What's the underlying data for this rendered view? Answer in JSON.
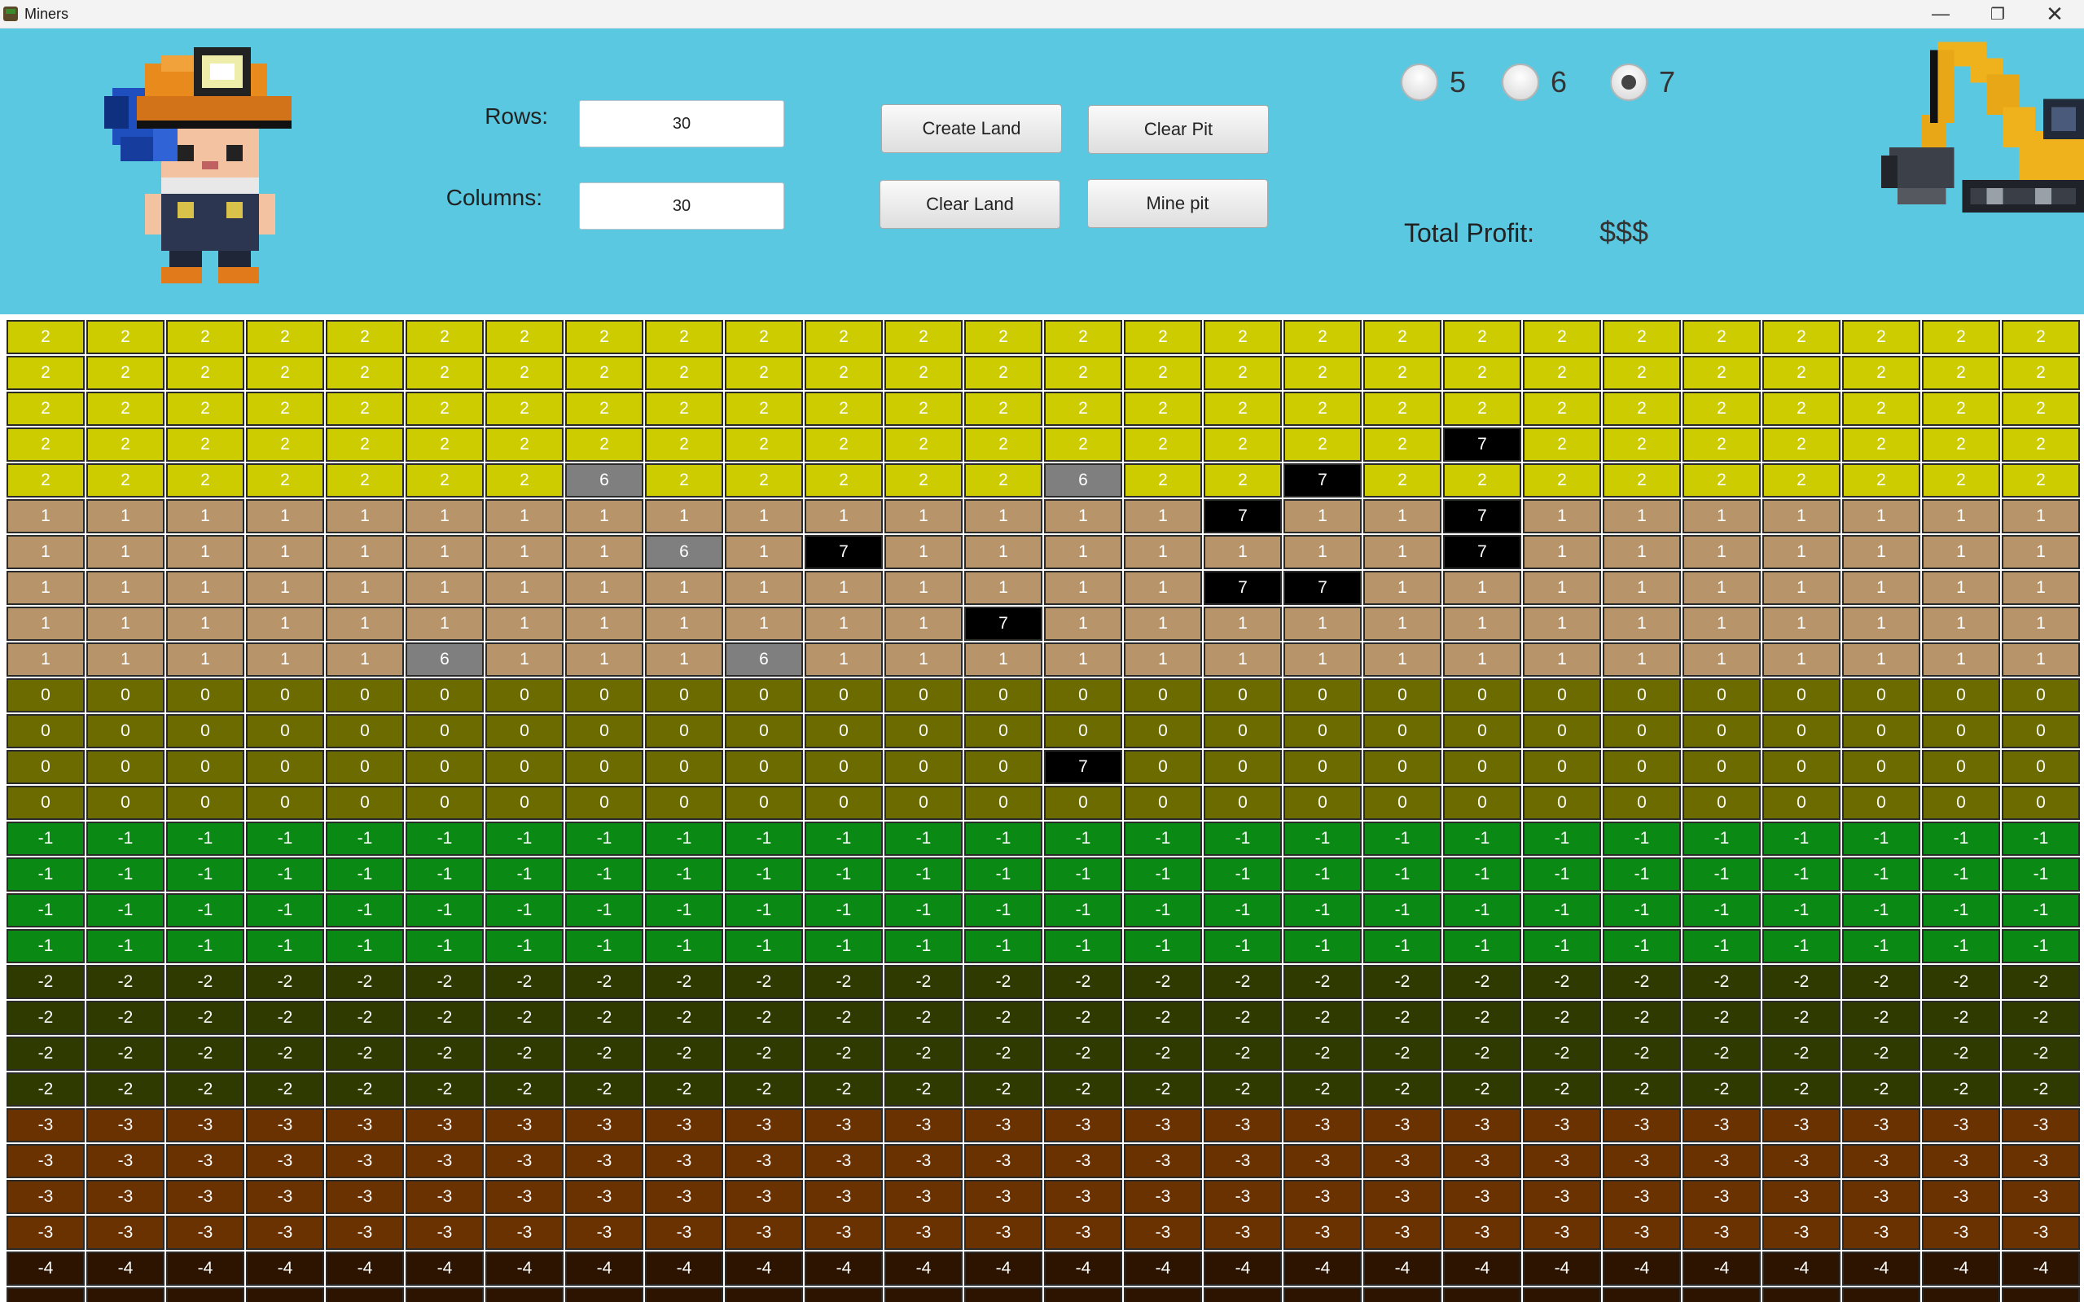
{
  "window": {
    "title": "Miners"
  },
  "header": {
    "rows_label": "Rows:",
    "rows_value": "30",
    "columns_label": "Columns:",
    "columns_value": "30",
    "buttons": {
      "create_land": "Create Land",
      "clear_pit": "Clear Pit",
      "clear_land": "Clear Land",
      "mine_pit": "Mine pit"
    },
    "radio_options": [
      "5",
      "6",
      "7"
    ],
    "selected_radio": "7",
    "total_profit_label": "Total Profit:",
    "total_profit_value": "$$$"
  },
  "colors": {
    "header_bg": "#5bc8e2",
    "level_2": "#cccc00",
    "level_1": "#b8946a",
    "level_0": "#6b6b00",
    "level_-1": "#0a8a14",
    "level_-2": "#2f3a00",
    "level_-3": "#6a3200",
    "level_-4": "#2c1400",
    "value_6": "#7f7f7f",
    "value_7": "#000000"
  },
  "grid": {
    "visible_columns": 26,
    "rows": [
      [
        "2",
        "2",
        "2",
        "2",
        "2",
        "2",
        "2",
        "2",
        "2",
        "2",
        "2",
        "2",
        "2",
        "2",
        "2",
        "2",
        "2",
        "2",
        "2",
        "2",
        "2",
        "2",
        "2",
        "2",
        "2",
        "2"
      ],
      [
        "2",
        "2",
        "2",
        "2",
        "2",
        "2",
        "2",
        "2",
        "2",
        "2",
        "2",
        "2",
        "2",
        "2",
        "2",
        "2",
        "2",
        "2",
        "2",
        "2",
        "2",
        "2",
        "2",
        "2",
        "2",
        "2"
      ],
      [
        "2",
        "2",
        "2",
        "2",
        "2",
        "2",
        "2",
        "2",
        "2",
        "2",
        "2",
        "2",
        "2",
        "2",
        "2",
        "2",
        "2",
        "2",
        "2",
        "2",
        "2",
        "2",
        "2",
        "2",
        "2",
        "2"
      ],
      [
        "2",
        "2",
        "2",
        "2",
        "2",
        "2",
        "2",
        "2",
        "2",
        "2",
        "2",
        "2",
        "2",
        "2",
        "2",
        "2",
        "2",
        "2",
        "7",
        "2",
        "2",
        "2",
        "2",
        "2",
        "2",
        "2"
      ],
      [
        "2",
        "2",
        "2",
        "2",
        "2",
        "2",
        "2",
        "6",
        "2",
        "2",
        "2",
        "2",
        "2",
        "6",
        "2",
        "2",
        "7",
        "2",
        "2",
        "2",
        "2",
        "2",
        "2",
        "2",
        "2",
        "2"
      ],
      [
        "1",
        "1",
        "1",
        "1",
        "1",
        "1",
        "1",
        "1",
        "1",
        "1",
        "1",
        "1",
        "1",
        "1",
        "1",
        "7",
        "1",
        "1",
        "7",
        "1",
        "1",
        "1",
        "1",
        "1",
        "1",
        "1"
      ],
      [
        "1",
        "1",
        "1",
        "1",
        "1",
        "1",
        "1",
        "1",
        "6",
        "1",
        "7",
        "1",
        "1",
        "1",
        "1",
        "1",
        "1",
        "1",
        "7",
        "1",
        "1",
        "1",
        "1",
        "1",
        "1",
        "1"
      ],
      [
        "1",
        "1",
        "1",
        "1",
        "1",
        "1",
        "1",
        "1",
        "1",
        "1",
        "1",
        "1",
        "1",
        "1",
        "1",
        "7",
        "7",
        "1",
        "1",
        "1",
        "1",
        "1",
        "1",
        "1",
        "1",
        "1"
      ],
      [
        "1",
        "1",
        "1",
        "1",
        "1",
        "1",
        "1",
        "1",
        "1",
        "1",
        "1",
        "1",
        "7",
        "1",
        "1",
        "1",
        "1",
        "1",
        "1",
        "1",
        "1",
        "1",
        "1",
        "1",
        "1",
        "1"
      ],
      [
        "1",
        "1",
        "1",
        "1",
        "1",
        "6",
        "1",
        "1",
        "1",
        "6",
        "1",
        "1",
        "1",
        "1",
        "1",
        "1",
        "1",
        "1",
        "1",
        "1",
        "1",
        "1",
        "1",
        "1",
        "1",
        "1"
      ],
      [
        "0",
        "0",
        "0",
        "0",
        "0",
        "0",
        "0",
        "0",
        "0",
        "0",
        "0",
        "0",
        "0",
        "0",
        "0",
        "0",
        "0",
        "0",
        "0",
        "0",
        "0",
        "0",
        "0",
        "0",
        "0",
        "0"
      ],
      [
        "0",
        "0",
        "0",
        "0",
        "0",
        "0",
        "0",
        "0",
        "0",
        "0",
        "0",
        "0",
        "0",
        "0",
        "0",
        "0",
        "0",
        "0",
        "0",
        "0",
        "0",
        "0",
        "0",
        "0",
        "0",
        "0"
      ],
      [
        "0",
        "0",
        "0",
        "0",
        "0",
        "0",
        "0",
        "0",
        "0",
        "0",
        "0",
        "0",
        "0",
        "7",
        "0",
        "0",
        "0",
        "0",
        "0",
        "0",
        "0",
        "0",
        "0",
        "0",
        "0",
        "0"
      ],
      [
        "0",
        "0",
        "0",
        "0",
        "0",
        "0",
        "0",
        "0",
        "0",
        "0",
        "0",
        "0",
        "0",
        "0",
        "0",
        "0",
        "0",
        "0",
        "0",
        "0",
        "0",
        "0",
        "0",
        "0",
        "0",
        "0"
      ],
      [
        "-1",
        "-1",
        "-1",
        "-1",
        "-1",
        "-1",
        "-1",
        "-1",
        "-1",
        "-1",
        "-1",
        "-1",
        "-1",
        "-1",
        "-1",
        "-1",
        "-1",
        "-1",
        "-1",
        "-1",
        "-1",
        "-1",
        "-1",
        "-1",
        "-1",
        "-1"
      ],
      [
        "-1",
        "-1",
        "-1",
        "-1",
        "-1",
        "-1",
        "-1",
        "-1",
        "-1",
        "-1",
        "-1",
        "-1",
        "-1",
        "-1",
        "-1",
        "-1",
        "-1",
        "-1",
        "-1",
        "-1",
        "-1",
        "-1",
        "-1",
        "-1",
        "-1",
        "-1"
      ],
      [
        "-1",
        "-1",
        "-1",
        "-1",
        "-1",
        "-1",
        "-1",
        "-1",
        "-1",
        "-1",
        "-1",
        "-1",
        "-1",
        "-1",
        "-1",
        "-1",
        "-1",
        "-1",
        "-1",
        "-1",
        "-1",
        "-1",
        "-1",
        "-1",
        "-1",
        "-1"
      ],
      [
        "-1",
        "-1",
        "-1",
        "-1",
        "-1",
        "-1",
        "-1",
        "-1",
        "-1",
        "-1",
        "-1",
        "-1",
        "-1",
        "-1",
        "-1",
        "-1",
        "-1",
        "-1",
        "-1",
        "-1",
        "-1",
        "-1",
        "-1",
        "-1",
        "-1",
        "-1"
      ],
      [
        "-2",
        "-2",
        "-2",
        "-2",
        "-2",
        "-2",
        "-2",
        "-2",
        "-2",
        "-2",
        "-2",
        "-2",
        "-2",
        "-2",
        "-2",
        "-2",
        "-2",
        "-2",
        "-2",
        "-2",
        "-2",
        "-2",
        "-2",
        "-2",
        "-2",
        "-2"
      ],
      [
        "-2",
        "-2",
        "-2",
        "-2",
        "-2",
        "-2",
        "-2",
        "-2",
        "-2",
        "-2",
        "-2",
        "-2",
        "-2",
        "-2",
        "-2",
        "-2",
        "-2",
        "-2",
        "-2",
        "-2",
        "-2",
        "-2",
        "-2",
        "-2",
        "-2",
        "-2"
      ],
      [
        "-2",
        "-2",
        "-2",
        "-2",
        "-2",
        "-2",
        "-2",
        "-2",
        "-2",
        "-2",
        "-2",
        "-2",
        "-2",
        "-2",
        "-2",
        "-2",
        "-2",
        "-2",
        "-2",
        "-2",
        "-2",
        "-2",
        "-2",
        "-2",
        "-2",
        "-2"
      ],
      [
        "-2",
        "-2",
        "-2",
        "-2",
        "-2",
        "-2",
        "-2",
        "-2",
        "-2",
        "-2",
        "-2",
        "-2",
        "-2",
        "-2",
        "-2",
        "-2",
        "-2",
        "-2",
        "-2",
        "-2",
        "-2",
        "-2",
        "-2",
        "-2",
        "-2",
        "-2"
      ],
      [
        "-3",
        "-3",
        "-3",
        "-3",
        "-3",
        "-3",
        "-3",
        "-3",
        "-3",
        "-3",
        "-3",
        "-3",
        "-3",
        "-3",
        "-3",
        "-3",
        "-3",
        "-3",
        "-3",
        "-3",
        "-3",
        "-3",
        "-3",
        "-3",
        "-3",
        "-3"
      ],
      [
        "-3",
        "-3",
        "-3",
        "-3",
        "-3",
        "-3",
        "-3",
        "-3",
        "-3",
        "-3",
        "-3",
        "-3",
        "-3",
        "-3",
        "-3",
        "-3",
        "-3",
        "-3",
        "-3",
        "-3",
        "-3",
        "-3",
        "-3",
        "-3",
        "-3",
        "-3"
      ],
      [
        "-3",
        "-3",
        "-3",
        "-3",
        "-3",
        "-3",
        "-3",
        "-3",
        "-3",
        "-3",
        "-3",
        "-3",
        "-3",
        "-3",
        "-3",
        "-3",
        "-3",
        "-3",
        "-3",
        "-3",
        "-3",
        "-3",
        "-3",
        "-3",
        "-3",
        "-3"
      ],
      [
        "-3",
        "-3",
        "-3",
        "-3",
        "-3",
        "-3",
        "-3",
        "-3",
        "-3",
        "-3",
        "-3",
        "-3",
        "-3",
        "-3",
        "-3",
        "-3",
        "-3",
        "-3",
        "-3",
        "-3",
        "-3",
        "-3",
        "-3",
        "-3",
        "-3",
        "-3"
      ],
      [
        "-4",
        "-4",
        "-4",
        "-4",
        "-4",
        "-4",
        "-4",
        "-4",
        "-4",
        "-4",
        "-4",
        "-4",
        "-4",
        "-4",
        "-4",
        "-4",
        "-4",
        "-4",
        "-4",
        "-4",
        "-4",
        "-4",
        "-4",
        "-4",
        "-4",
        "-4"
      ],
      [
        "",
        "",
        "",
        "",
        "",
        "",
        "",
        "",
        "",
        "",
        "",
        "",
        "",
        "",
        "",
        "",
        "",
        "",
        "",
        "",
        "",
        "",
        "",
        "",
        "",
        ""
      ]
    ]
  }
}
